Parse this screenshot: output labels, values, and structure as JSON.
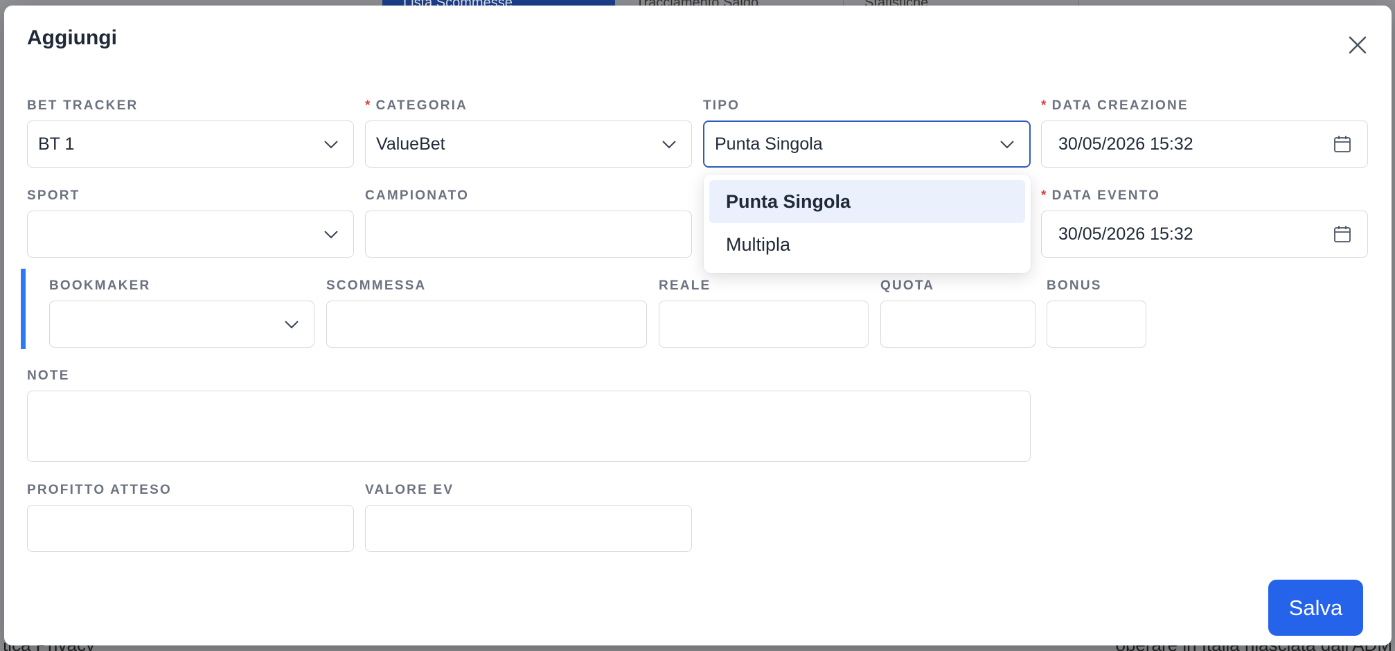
{
  "background": {
    "tabs": [
      "Lista Scommesse",
      "Tracciamento Saldo",
      "Statistiche"
    ],
    "footer_left": "tica Privacy",
    "footer_right": "operare in Italia rilasciata dall'ADM"
  },
  "modal": {
    "title": "Aggiungi",
    "close_icon": "close-icon",
    "save_label": "Salva"
  },
  "fields": {
    "bet_tracker": {
      "label": "BET TRACKER",
      "value": "BT 1"
    },
    "categoria": {
      "label": "CATEGORIA",
      "required": "*",
      "value": "ValueBet"
    },
    "tipo": {
      "label": "TIPO",
      "value": "Punta Singola"
    },
    "data_creazione": {
      "label": "DATA CREAZIONE",
      "required": "*",
      "value": "30/05/2026 15:32"
    },
    "sport": {
      "label": "SPORT",
      "value": ""
    },
    "campionato": {
      "label": "CAMPIONATO",
      "value": ""
    },
    "data_evento": {
      "label": "DATA EVENTO",
      "required": "*",
      "value": "30/05/2026 15:32"
    },
    "bookmaker": {
      "label": "BOOKMAKER",
      "value": ""
    },
    "scommessa": {
      "label": "SCOMMESSA",
      "value": ""
    },
    "reale": {
      "label": "REALE",
      "value": ""
    },
    "quota": {
      "label": "QUOTA",
      "value": ""
    },
    "bonus": {
      "label": "BONUS",
      "value": ""
    },
    "note": {
      "label": "NOTE",
      "value": ""
    },
    "profitto_atteso": {
      "label": "PROFITTO ATTESO",
      "value": ""
    },
    "valore_ev": {
      "label": "VALORE EV",
      "value": ""
    }
  },
  "tipo_dropdown": {
    "options": [
      "Punta Singola",
      "Multipla"
    ],
    "selected": "Punta Singola"
  },
  "colors": {
    "accent": "#2563eb",
    "focus_border": "#2f5bbd",
    "required": "#e23c3c",
    "bookmaker_bar": "#2b7cf0",
    "selected_option_bg": "#eaf1fd"
  }
}
